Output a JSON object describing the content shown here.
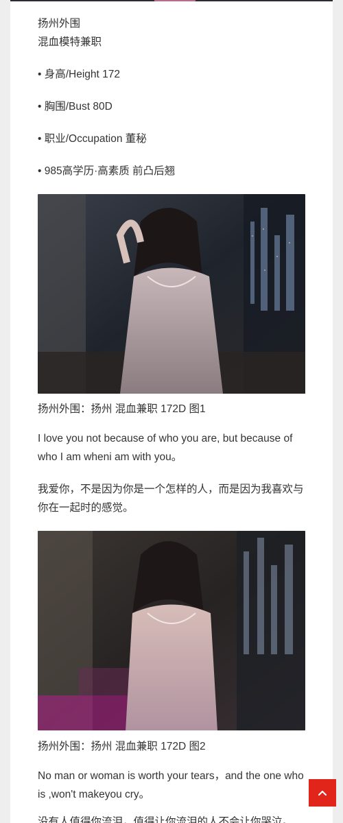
{
  "article": {
    "line_location": "扬州外围",
    "line_title": "混血模特兼职",
    "spec_height": "• 身高/Height 172",
    "spec_bust": "• 胸围/Bust 80D",
    "spec_occupation": "• 职业/Occupation 董秘",
    "spec_traits": "• 985高学历·高素质 前凸后翘",
    "caption_1": "扬州外围：扬州 混血兼职 172D 图1",
    "quote_1_en": "I love you not because of who you are, but because of who I am wheni am with you。",
    "quote_1_zh": "我爱你，不是因为你是一个怎样的人，而是因为我喜欢与你在一起时的感觉。",
    "caption_2": "扬州外围：扬州 混血兼职 172D 图2",
    "quote_2_en": "No man or woman is worth your tears，and the one who is ,won't makeyou cry。",
    "quote_2_zh_partial": "没有人值得你流泪，值得让你流泪的人不会让你哭泣。"
  },
  "photos": [
    {
      "icon": "photo-woman-city-night",
      "scene": "dark"
    },
    {
      "icon": "photo-woman-city-night",
      "scene": "warm"
    }
  ],
  "scroll_top": {
    "icon": "chevron-up-icon",
    "color": "#e1251b"
  }
}
